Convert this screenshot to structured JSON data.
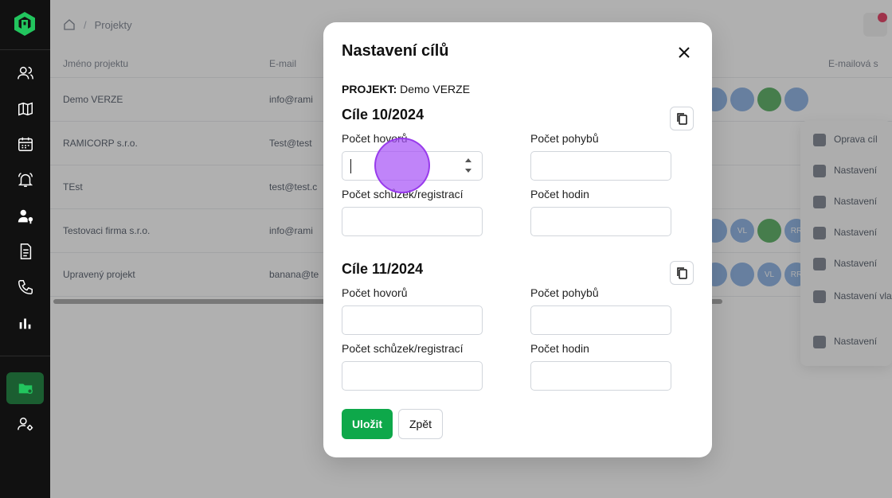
{
  "breadcrumb": {
    "current": "Projekty"
  },
  "table": {
    "headers": [
      "Jméno projektu",
      "E-mail",
      "E-mailová s"
    ],
    "rows": [
      {
        "name": "Demo VERZE",
        "email": "info@rami"
      },
      {
        "name": "RAMICORP s.r.o.",
        "email": "Test@test"
      },
      {
        "name": "TEst",
        "email": "test@test.c"
      },
      {
        "name": "Testovaci firma s.r.o.",
        "email": "info@rami"
      },
      {
        "name": "Upravený projekt",
        "email": "banana@te"
      }
    ],
    "avatar_labels": [
      "RR",
      "VL",
      "RR"
    ]
  },
  "context_menu": {
    "items": [
      "Oprava cíl",
      "Nastavení",
      "Nastavení",
      "Nastavení",
      "Nastavení",
      "Nastavení vlastních",
      "Nastavení"
    ]
  },
  "modal": {
    "title": "Nastavení cílů",
    "project_label": "PROJEKT:",
    "project_name": "Demo VERZE",
    "sections": [
      {
        "title": "Cíle 10/2024",
        "fields": {
          "calls_label": "Počet hovorů",
          "moves_label": "Počet pohybů",
          "meetings_label": "Počet schůzek/registrací",
          "hours_label": "Počet hodin"
        }
      },
      {
        "title": "Cíle 11/2024",
        "fields": {
          "calls_label": "Počet hovorů",
          "moves_label": "Počet pohybů",
          "meetings_label": "Počet schůzek/registrací",
          "hours_label": "Počet hodin"
        }
      }
    ],
    "save_label": "Uložit",
    "back_label": "Zpět"
  },
  "colors": {
    "sidebar_bg": "#111111",
    "accent_green": "#0ea84a",
    "active_item_bg": "#1b5e31",
    "click_indicator": "#a855f7"
  },
  "icons": {
    "sidebar": [
      "users-icon",
      "map-icon",
      "calendar-icon",
      "bell-icon",
      "user-settings-icon",
      "document-icon",
      "phone-icon",
      "chart-icon",
      "folder-icon",
      "user-gear-icon"
    ],
    "modal": [
      "close-icon",
      "copy-icon"
    ]
  }
}
